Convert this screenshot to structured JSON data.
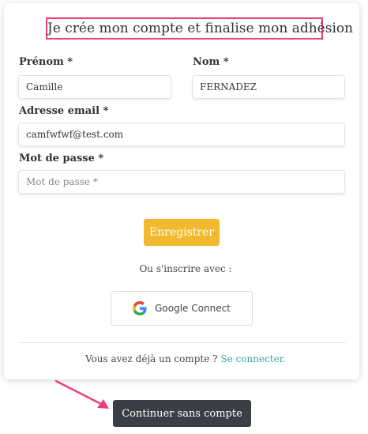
{
  "form": {
    "title": "Je crée mon compte et finalise mon adhésion",
    "first_name": {
      "label": "Prénom *",
      "value": "Camille"
    },
    "last_name": {
      "label": "Nom *",
      "value": "FERNADEZ"
    },
    "email": {
      "label": "Adresse email *",
      "value": "camfwfwf@test.com"
    },
    "password": {
      "label": "Mot de passe *",
      "placeholder": "Mot de passe *"
    },
    "register_label": "Enregistrer",
    "or_text": "Ou s'inscrire avec :",
    "google_label": "Google Connect",
    "already_text": "Vous avez déjà un compte ?",
    "login_link": "Se connecter."
  },
  "continue_label": "Continuer sans compte",
  "colors": {
    "highlight_border": "#e8417a",
    "register_button": "#f2b92e",
    "link": "#3aa89a",
    "continue_button": "#3a3f45",
    "arrow": "#e8417a"
  },
  "icons": {
    "google": "google-icon",
    "arrow": "arrow-annotation"
  }
}
